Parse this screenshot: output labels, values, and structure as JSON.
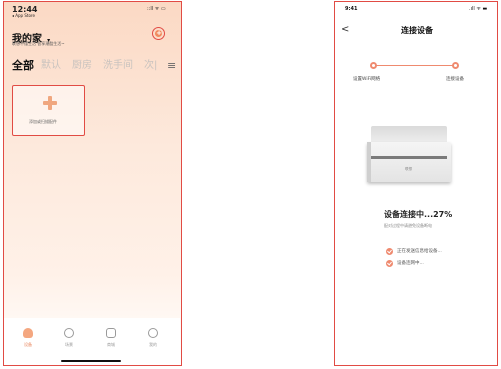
{
  "left_phone": {
    "status": {
      "time": "12:44",
      "back_app": "◂ App Store",
      "icons": "::ll ᯤ ▭"
    },
    "header": {
      "title": "我的家",
      "title_caret": "▾",
      "subtitle": "联想不懂生活 智享潮酷生活~",
      "add_icon": "+"
    },
    "tabs": [
      {
        "label": "全部",
        "active": true
      },
      {
        "label": "默认",
        "active": false
      },
      {
        "label": "厨房",
        "active": false
      },
      {
        "label": "洗手间",
        "active": false
      },
      {
        "label": "次|",
        "active": false
      }
    ],
    "menu_icon": "≡",
    "add_card": {
      "label": "添加或扫描配件"
    },
    "bottom_nav": [
      {
        "label": "设备"
      },
      {
        "label": "场景"
      },
      {
        "label": "商城"
      },
      {
        "label": "我的"
      }
    ]
  },
  "right_phone": {
    "status": {
      "time": "9:41",
      "icons": ".ıll ᯤ ▬"
    },
    "header": {
      "back": "<",
      "title": "连接设备"
    },
    "steps": [
      {
        "label": "设置WiFi网络"
      },
      {
        "label": "连接设备"
      }
    ],
    "printer_logo": "联想",
    "progress": {
      "title": "设备连接中...27%",
      "percent": 27,
      "subtitle": "配对过程中请避免设备断电"
    },
    "status_items": [
      {
        "label": "正在发送信息给设备..."
      },
      {
        "label": "设备连网中..."
      }
    ]
  },
  "colors": {
    "accent": "#ef8a6f",
    "frame": "#e14b44"
  }
}
